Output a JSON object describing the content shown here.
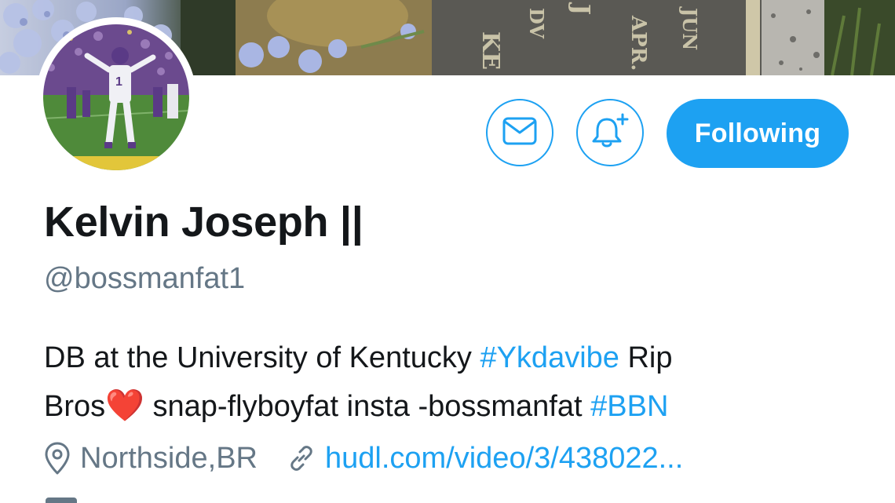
{
  "profile": {
    "display_name": "Kelvin Joseph",
    "name_suffix": "||",
    "handle": "@bossmanfat1",
    "bio": {
      "line1_text": "DB at the University of Kentucky ",
      "line1_hashtag": "#Ykdavibe",
      "line1_tail": " Rip",
      "line2_text": "Bros",
      "line2_emoji": "❤️",
      "line2_tail": " snap-flyboyfat insta -bossmanfat ",
      "line2_hashtag": "#BBN"
    },
    "location": "Northside,BR",
    "website": "hudl.com/video/3/438022..."
  },
  "actions": {
    "message_icon": "envelope-icon",
    "notify_icon": "bell-plus-icon",
    "follow_label": "Following"
  },
  "banner": {
    "engraved_letters": [
      "KE",
      "DV",
      "J",
      "APR.",
      "JUN"
    ]
  },
  "colors": {
    "accent": "#1da1f2",
    "text_primary": "#14171a",
    "text_secondary": "#657786"
  }
}
